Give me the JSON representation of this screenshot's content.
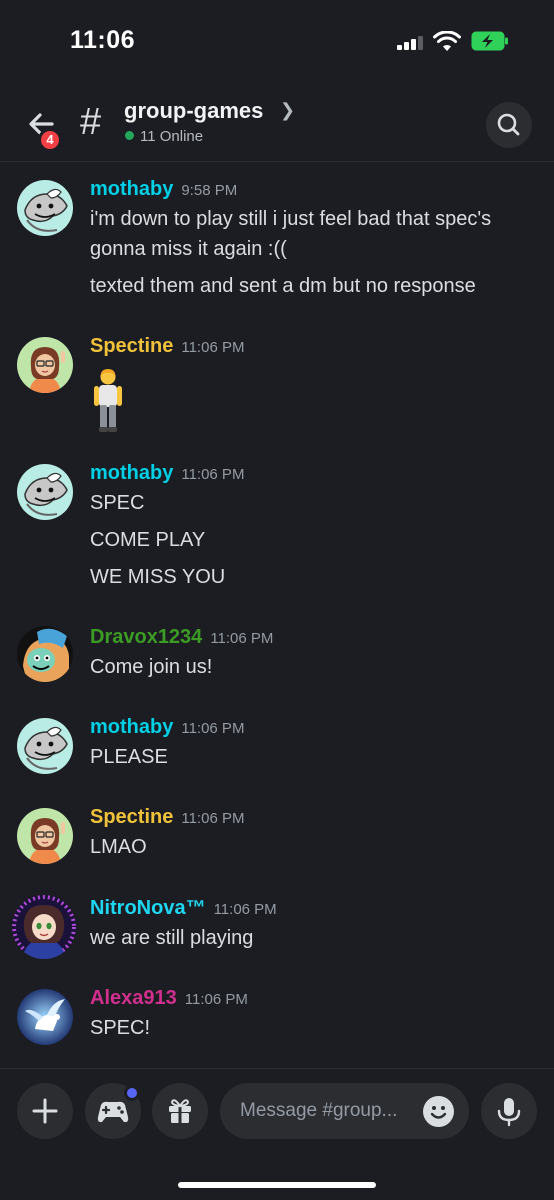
{
  "status_bar": {
    "time": "11:06"
  },
  "header": {
    "back_badge": "4",
    "channel_name": "group-games",
    "online_text": "11 Online"
  },
  "colors": {
    "mothaby": "#00d0e6",
    "spectine": "#f0c23b",
    "dravox": "#3b9b25",
    "nitronova": "#1fd6f0",
    "alexa": "#d12f8d",
    "online": "#23a55a",
    "badge": "#f23f43",
    "accent": "#5865f2"
  },
  "messages": [
    {
      "author": "mothaby",
      "time": "9:58 PM",
      "lines": [
        "i'm down to play still i just feel bad that spec's",
        "gonna miss it again :((",
        "texted them and sent a dm but no response"
      ]
    },
    {
      "author": "Spectine",
      "time": "11:06 PM",
      "lines": [],
      "emoji": "🧍"
    },
    {
      "author": "mothaby",
      "time": "11:06 PM",
      "lines": [
        "SPEC",
        "COME PLAY",
        "WE MISS YOU"
      ]
    },
    {
      "author": "Dravox1234",
      "time": "11:06 PM",
      "lines": [
        "Come join us!"
      ]
    },
    {
      "author": "mothaby",
      "time": "11:06 PM",
      "lines": [
        "PLEASE"
      ]
    },
    {
      "author": "Spectine",
      "time": "11:06 PM",
      "lines": [
        "LMAO"
      ]
    },
    {
      "author": "NitroNova™",
      "time": "11:06 PM",
      "lines": [
        "we are still playing"
      ]
    },
    {
      "author": "Alexa913",
      "time": "11:06 PM",
      "lines": [
        "SPEC!"
      ]
    }
  ],
  "composer": {
    "placeholder": "Message #group...",
    "icons": [
      "plus-icon",
      "gamepad-icon",
      "gift-icon",
      "emoji-icon",
      "microphone-icon"
    ]
  }
}
